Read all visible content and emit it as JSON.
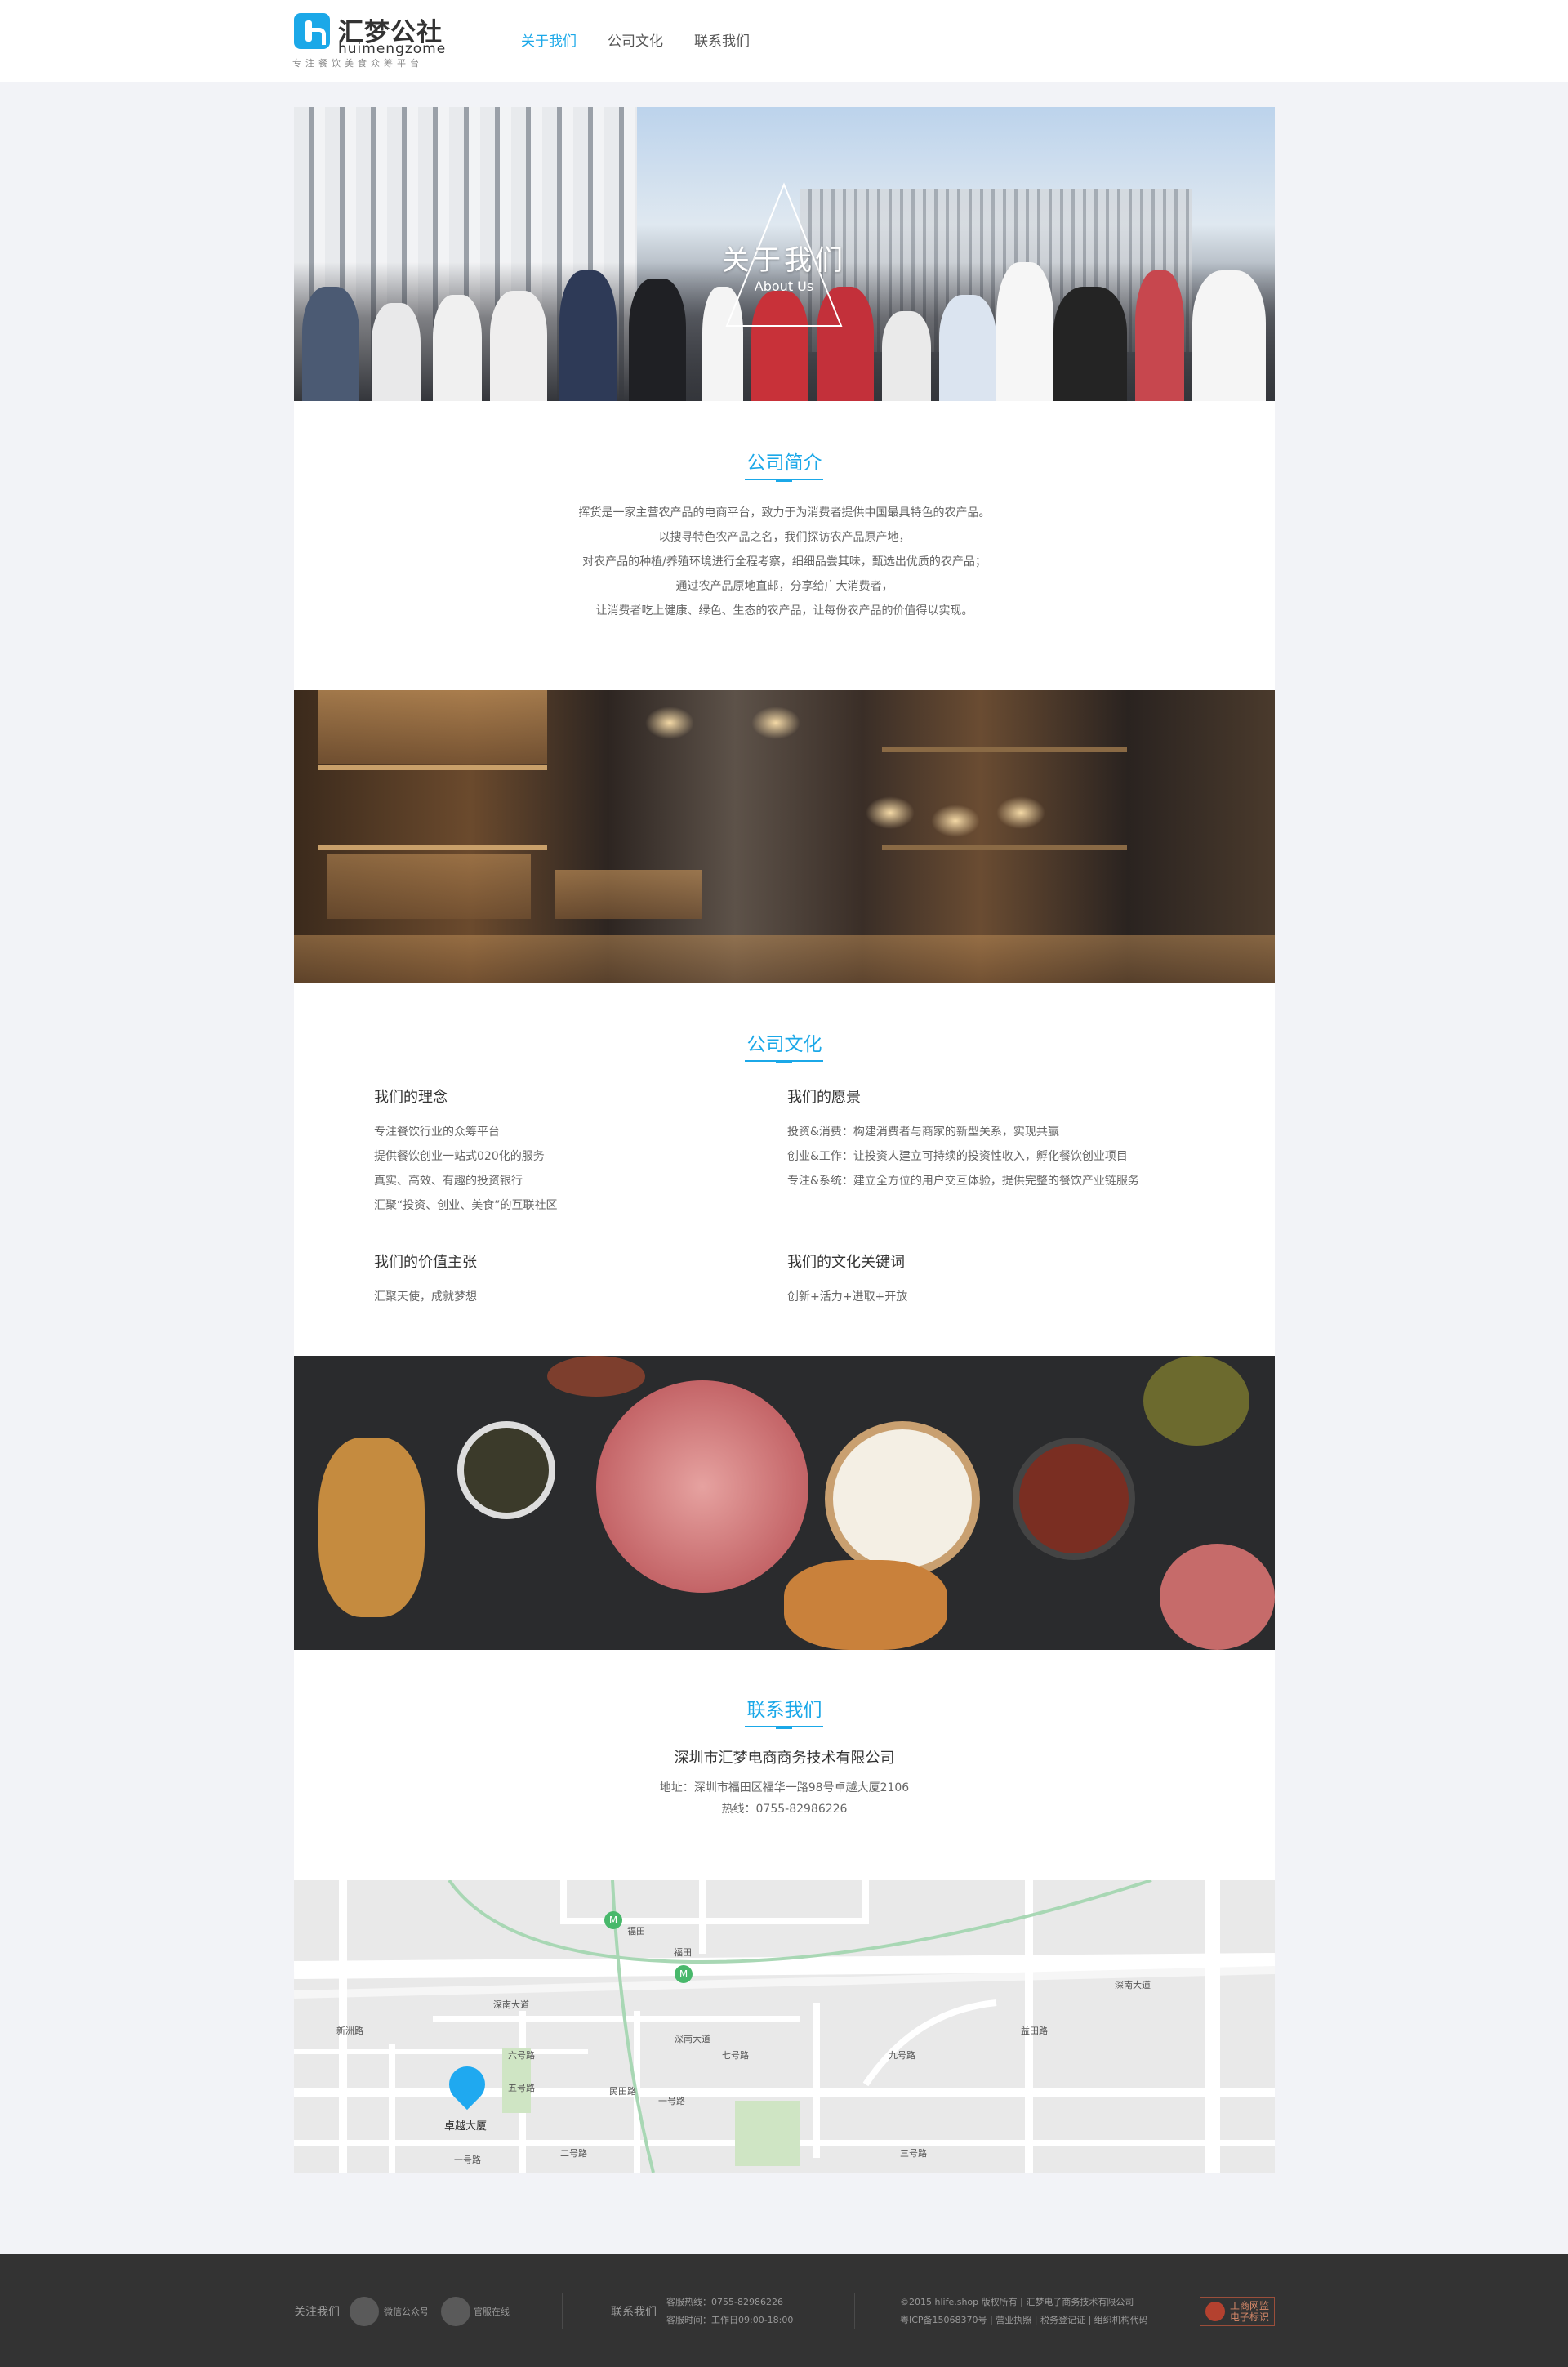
{
  "header": {
    "logo": {
      "cn": "汇梦公社",
      "en": "huimengzome",
      "tagline": "专注餐饮美食众筹平台"
    },
    "nav": [
      {
        "label": "关于我们",
        "active": true
      },
      {
        "label": "公司文化",
        "active": false
      },
      {
        "label": "联系我们",
        "active": false
      }
    ]
  },
  "hero": {
    "title": "关于我们",
    "subtitle": "About Us"
  },
  "intro": {
    "title": "公司简介",
    "lines": [
      "挥货是一家主营农产品的电商平台，致力于为消费者提供中国最具特色的农产品。",
      "以搜寻特色农产品之名，我们探访农产品原产地，",
      "对农产品的种植/养殖环境进行全程考察，细细品尝其味，甄选出优质的农产品；",
      "通过农产品原地直邮，分享给广大消费者，",
      "让消费者吃上健康、绿色、生态的农产品，让每份农产品的价值得以实现。"
    ]
  },
  "culture": {
    "title": "公司文化",
    "blocks": [
      {
        "heading": "我们的理念",
        "lines": [
          "专注餐饮行业的众筹平台",
          "提供餐饮创业一站式020化的服务",
          "真实、高效、有趣的投资银行",
          "汇聚“投资、创业、美食”的互联社区"
        ]
      },
      {
        "heading": "我们的愿景",
        "lines": [
          "投资&消费：构建消费者与商家的新型关系，实现共赢",
          "创业&工作：让投资人建立可持续的投资性收入，孵化餐饮创业项目",
          "专注&系统：建立全方位的用户交互体验，提供完整的餐饮产业链服务"
        ]
      },
      {
        "heading": "我们的价值主张",
        "lines": [
          "汇聚天使，成就梦想"
        ]
      },
      {
        "heading": "我们的文化关键词",
        "lines": [
          "创新+活力+进取+开放"
        ]
      }
    ]
  },
  "contact": {
    "title": "联系我们",
    "company": "深圳市汇梦电商商务技术有限公司",
    "address": "地址：深圳市福田区福华一路98号卓越大厦2106",
    "phone": "热线：0755-82986226"
  },
  "map": {
    "marker_label": "卓越大厦",
    "labels": [
      "福田",
      "福田",
      "深南大道",
      "深南大道",
      "深南大道",
      "新洲路",
      "益田路",
      "民田路",
      "一号路",
      "一号路",
      "二号路",
      "三号路",
      "五号路",
      "六号路",
      "七号路",
      "九号路"
    ]
  },
  "footer": {
    "follow_label": "关注我们",
    "wechat_label": "微信公众号",
    "qq_label": "官服在线",
    "contact_label": "联系我们",
    "service_phone": "客服热线：0755-82986226",
    "service_hours": "客服时间：工作日09:00-18:00",
    "copyright": "©2015 hlife.shop 版权所有 | 汇梦电子商务技术有限公司",
    "icp_links": [
      "粤ICP备15068370号",
      "营业执照",
      "税务登记证",
      "组织机构代码"
    ],
    "badge_text": [
      "工商网监",
      "电子标识"
    ]
  },
  "colors": {
    "accent": "#1ba8e8",
    "page_bg": "#f2f3f7",
    "footer_bg": "#333333",
    "pin": "#1fa9f0"
  }
}
